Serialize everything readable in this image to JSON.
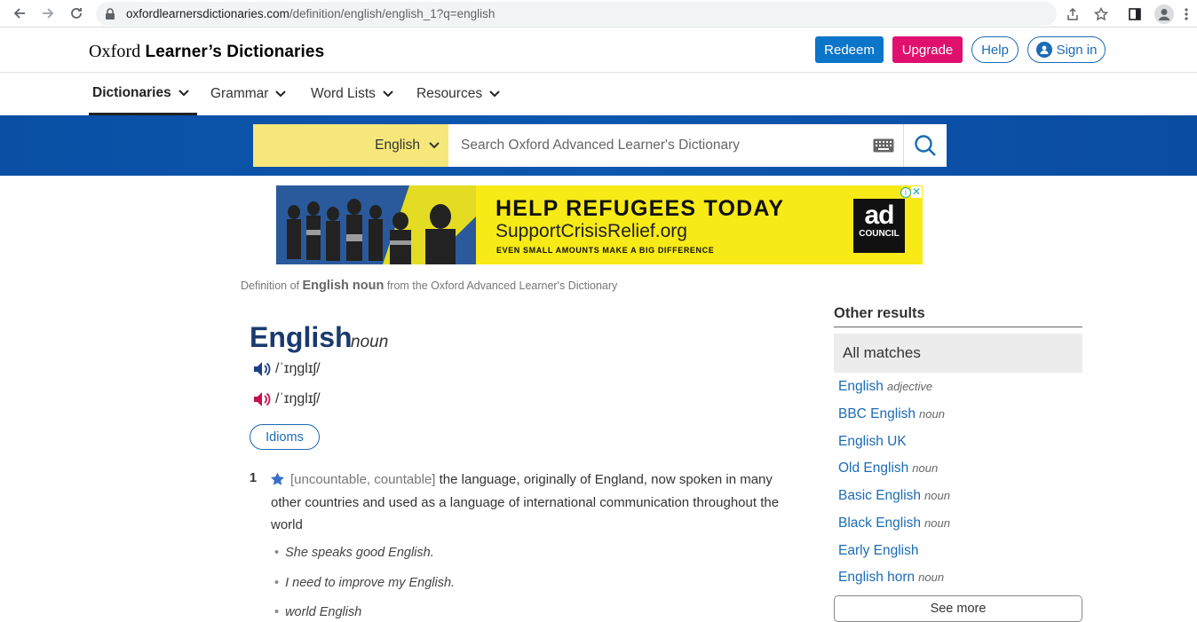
{
  "browser": {
    "url_domain": "oxfordlearnersdictionaries.com",
    "url_path": "/definition/english/english_1?q=english"
  },
  "header": {
    "logo_prefix": "Oxford",
    "logo_main": "Learner’s Dictionaries",
    "redeem": "Redeem",
    "upgrade": "Upgrade",
    "help": "Help",
    "sign_in": "Sign in"
  },
  "nav": {
    "items": [
      {
        "label": "Dictionaries"
      },
      {
        "label": "Grammar"
      },
      {
        "label": "Word Lists"
      },
      {
        "label": "Resources"
      }
    ]
  },
  "search": {
    "language": "English",
    "placeholder": "Search Oxford Advanced Learner's Dictionary"
  },
  "ad": {
    "headline": "HELP REFUGEES TODAY",
    "url": "SupportCrisisRelief.org",
    "tagline": "EVEN SMALL AMOUNTS MAKE A BIG DIFFERENCE",
    "logo_top": "ad",
    "logo_bottom": "COUNCIL"
  },
  "entry": {
    "def_of_prefix": "Definition of",
    "def_of_word": "English noun",
    "def_of_suffix": "from the Oxford Advanced Learner's Dictionary",
    "headword": "English",
    "pos": "noun",
    "pron_uk": "/ˈɪŋɡlɪʃ/",
    "pron_us": "/ˈɪŋɡlɪʃ/",
    "idioms": "Idioms",
    "sense_num": "1",
    "sense_grammar": "[uncountable, countable]",
    "sense_def": "the language, originally of England, now spoken in many other countries and used as a language of international communication throughout the world",
    "examples": [
      "She speaks good English.",
      "I need to improve my English.",
      "world English"
    ]
  },
  "sidebar": {
    "heading": "Other results",
    "all_matches": "All matches",
    "results": [
      {
        "word": "English",
        "pos": "adjective"
      },
      {
        "word": "BBC English",
        "pos": "noun"
      },
      {
        "word": "English UK",
        "pos": ""
      },
      {
        "word": "Old English",
        "pos": "noun"
      },
      {
        "word": "Basic English",
        "pos": "noun"
      },
      {
        "word": "Black English",
        "pos": "noun"
      },
      {
        "word": "Early English",
        "pos": ""
      },
      {
        "word": "English horn",
        "pos": "noun"
      }
    ],
    "see_more": "See more"
  },
  "colors": {
    "brand_blue": "#0b75c9",
    "upgrade_pink": "#e0106e",
    "band_blue": "#0d57b0",
    "lang_yellow": "#f6e77a",
    "ad_yellow": "#f7ea16"
  }
}
